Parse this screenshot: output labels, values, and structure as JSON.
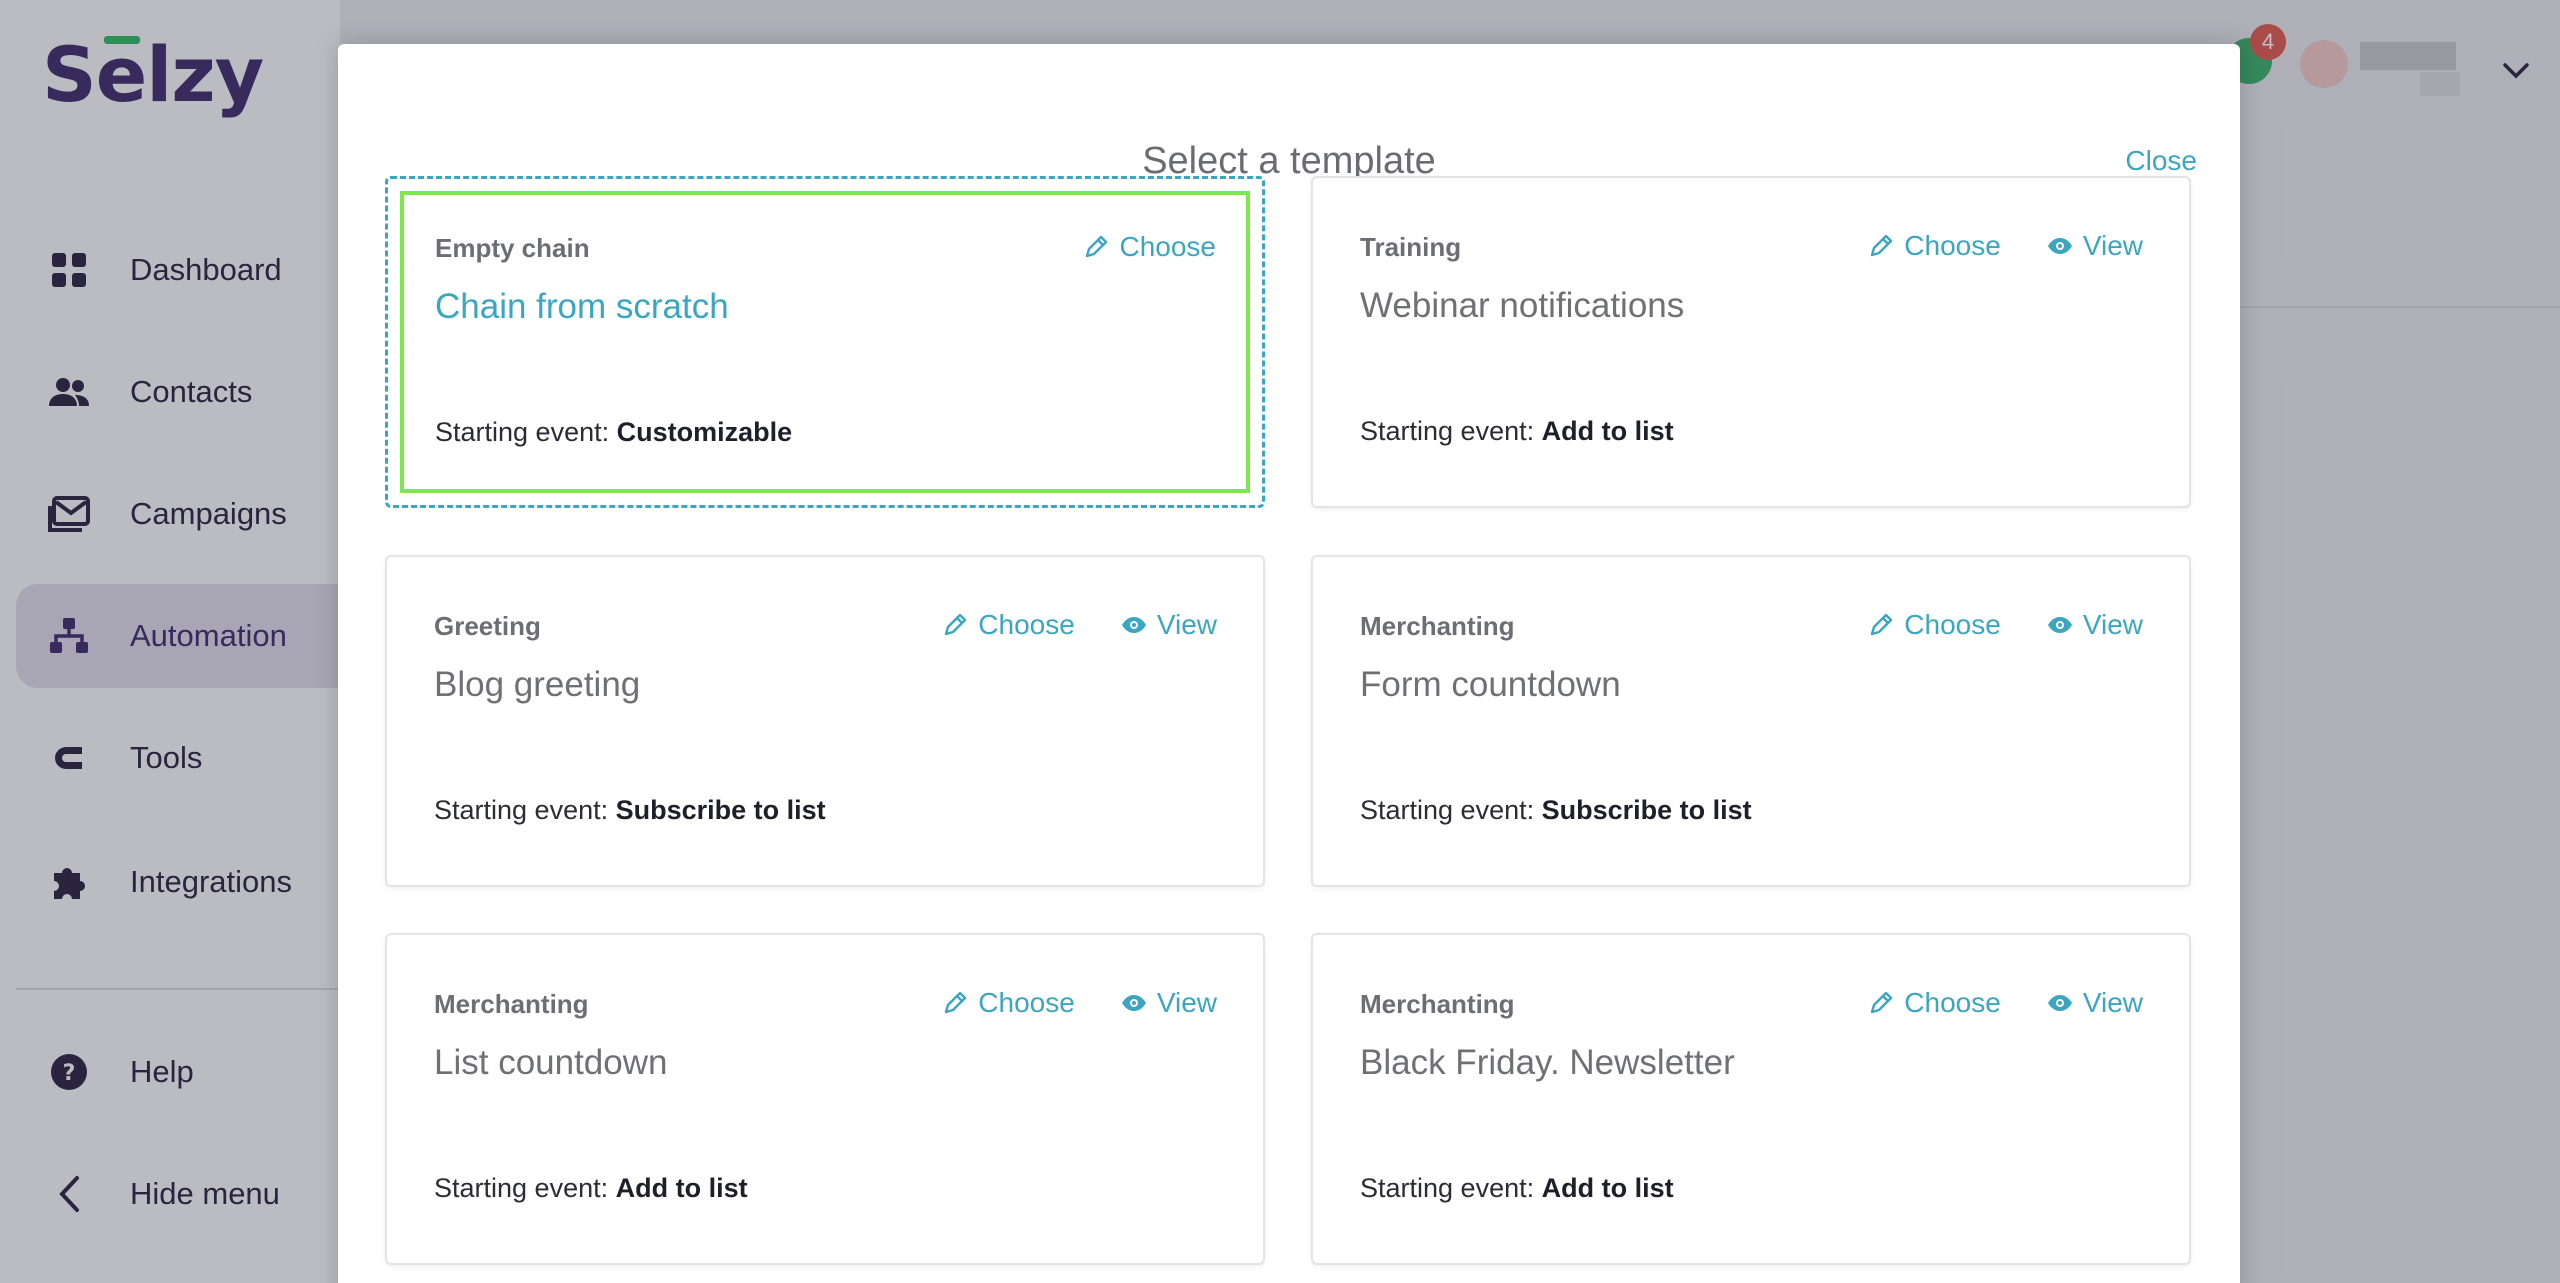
{
  "app": {
    "logo": "Selzy",
    "brand_color": "#3e2a6c",
    "accent_color": "#3aa6c1"
  },
  "sidebar": {
    "items": [
      {
        "label": "Dashboard",
        "icon": "dashboard-icon"
      },
      {
        "label": "Contacts",
        "icon": "contacts-icon"
      },
      {
        "label": "Campaigns",
        "icon": "campaigns-icon"
      },
      {
        "label": "Automation",
        "icon": "automation-icon",
        "active": true
      },
      {
        "label": "Tools",
        "icon": "tools-icon"
      },
      {
        "label": "Integrations",
        "icon": "puzzle-icon"
      }
    ],
    "footer": [
      {
        "label": "Help",
        "icon": "help-icon"
      },
      {
        "label": "Hide menu",
        "icon": "chevron-left-icon"
      }
    ]
  },
  "topbar": {
    "notification_count": "4"
  },
  "modal": {
    "title": "Select a template",
    "close_label": "Close",
    "starting_event_prefix": "Starting event:",
    "choose_label": "Choose",
    "view_label": "View",
    "cards": [
      {
        "category": "Empty chain",
        "title": "Chain from scratch",
        "event": "Customizable",
        "has_view": false,
        "selected": true
      },
      {
        "category": "Training",
        "title": "Webinar notifications",
        "event": "Add to list",
        "has_view": true
      },
      {
        "category": "Greeting",
        "title": "Blog greeting",
        "event": "Subscribe to list",
        "has_view": true
      },
      {
        "category": "Merchanting",
        "title": "Form countdown",
        "event": "Subscribe to list",
        "has_view": true
      },
      {
        "category": "Merchanting",
        "title": "List countdown",
        "event": "Add to list",
        "has_view": true
      },
      {
        "category": "Merchanting",
        "title": "Black Friday. Newsletter",
        "event": "Add to list",
        "has_view": true
      }
    ]
  }
}
